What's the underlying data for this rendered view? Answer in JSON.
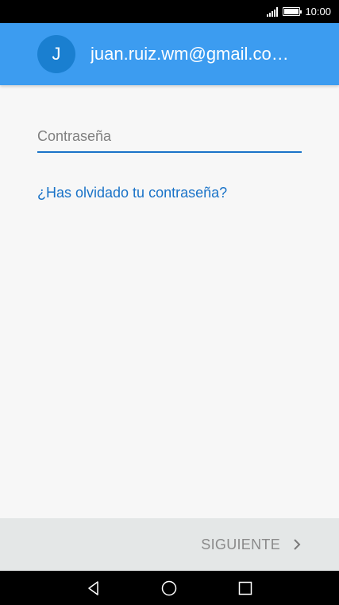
{
  "status_bar": {
    "time": "10:00",
    "signal_icon": "signal-icon",
    "battery_icon": "battery-icon"
  },
  "header": {
    "avatar_letter": "J",
    "account_email": "juan.ruiz.wm@gmail.co…",
    "background_color": "#3c9cf0"
  },
  "form": {
    "password_placeholder": "Contraseña",
    "password_value": "",
    "forgot_password_link": "¿Has olvidado tu contraseña?"
  },
  "actions": {
    "next_label": "SIGUIENTE",
    "next_icon": "chevron-right-icon"
  },
  "nav_bar": {
    "back_icon": "back-icon",
    "home_icon": "home-icon",
    "recents_icon": "recents-icon"
  },
  "colors": {
    "accent": "#1a73c8",
    "header": "#3c9cf0",
    "action_bar": "#e4e7e7"
  }
}
